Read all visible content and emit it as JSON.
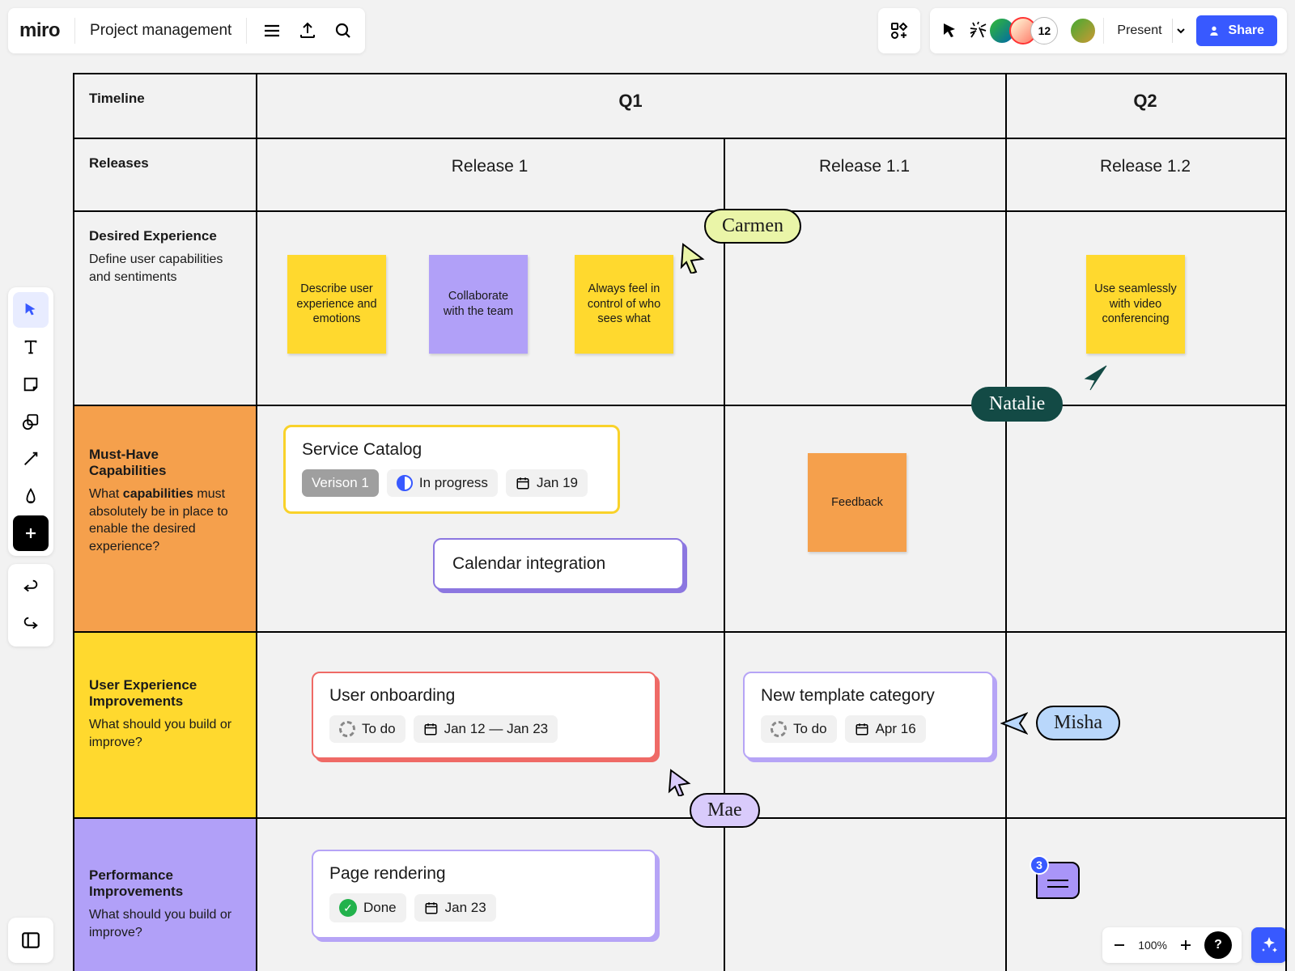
{
  "app": {
    "logo_text": "miro",
    "board_title": "Project management"
  },
  "topbar": {
    "collab_count": "12",
    "present_label": "Present",
    "share_label": "Share"
  },
  "zoom": {
    "percent": "100%"
  },
  "grid": {
    "row_labels": {
      "timeline": "Timeline",
      "releases": "Releases",
      "desired": {
        "title": "Desired Experience",
        "sub": "Define user capabilities and sentiments"
      },
      "must": {
        "title": "Must-Have Capabilities",
        "sub_prefix": "What ",
        "sub_bold": "capabilities",
        "sub_suffix": " must absolutely be in place to enable the desired experience?"
      },
      "ux": {
        "title": "User Experience Improvements",
        "sub": "What should you build or improve?"
      },
      "perf": {
        "title": "Performance Improvements",
        "sub": "What should you build or improve?"
      }
    },
    "cols": {
      "q1": "Q1",
      "q2": "Q2",
      "r1": "Release 1",
      "r11": "Release 1.1",
      "r12": "Release 1.2"
    }
  },
  "stickies": {
    "s1": "Describe user experience and emotions",
    "s2": "Collaborate with the team",
    "s3": "Always feel in control of who sees what",
    "s4": "Use seamlessly with video conferencing",
    "s5": "Feedback"
  },
  "cards": {
    "service": {
      "title": "Service Catalog",
      "tag": "Verison 1",
      "status": "In progress",
      "date": "Jan 19"
    },
    "calendar": {
      "title": "Calendar integration"
    },
    "onboard": {
      "title": "User onboarding",
      "status": "To do",
      "date": "Jan 12 — Jan 23"
    },
    "template": {
      "title": "New template category",
      "status": "To do",
      "date": "Apr 16"
    },
    "render": {
      "title": "Page rendering",
      "status": "Done",
      "date": "Jan 23"
    }
  },
  "cursors": {
    "carmen": "Carmen",
    "natalie": "Natalie",
    "mae": "Mae",
    "misha": "Misha"
  },
  "comment_badge": "3"
}
